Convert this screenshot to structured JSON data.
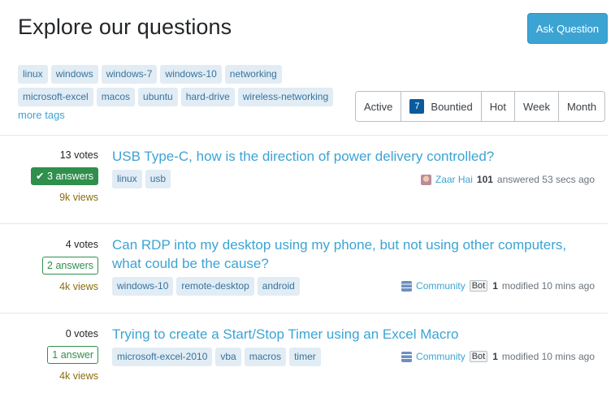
{
  "header": {
    "title": "Explore our questions",
    "ask_label": "Ask Question"
  },
  "top_tags": {
    "row1": [
      "linux",
      "windows",
      "windows-7",
      "windows-10",
      "networking"
    ],
    "row2": [
      "microsoft-excel",
      "macos",
      "ubuntu",
      "hard-drive",
      "wireless-networking"
    ],
    "more": "more tags"
  },
  "filters": {
    "active": "Active",
    "bountied_count": "7",
    "bountied": "Bountied",
    "hot": "Hot",
    "week": "Week",
    "month": "Month"
  },
  "questions": [
    {
      "votes": "13 votes",
      "answers": "3 answers",
      "accepted": true,
      "views": "9k views",
      "title": "USB Type-C, how is the direction of power delivery controlled?",
      "tags": [
        "linux",
        "usb"
      ],
      "user": "Zaar Hai",
      "rep": "101",
      "action": "answered 53 secs ago",
      "avatar": "user-avatar-icon"
    },
    {
      "votes": "4 votes",
      "answers": "2 answers",
      "accepted": false,
      "views": "4k views",
      "title": "Can RDP into my desktop using my phone, but not using other computers, what could be the cause?",
      "tags": [
        "windows-10",
        "remote-desktop",
        "android"
      ],
      "user": "Community",
      "bot": "Bot",
      "rep": "1",
      "action": "modified 10 mins ago",
      "avatar": "community-icon"
    },
    {
      "votes": "0 votes",
      "answers": "1 answer",
      "accepted": false,
      "views": "4k views",
      "title": "Trying to create a Start/Stop Timer using an Excel Macro",
      "tags": [
        "microsoft-excel-2010",
        "vba",
        "macros",
        "timer"
      ],
      "user": "Community",
      "bot": "Bot",
      "rep": "1",
      "action": "modified 10 mins ago",
      "avatar": "community-icon"
    }
  ]
}
